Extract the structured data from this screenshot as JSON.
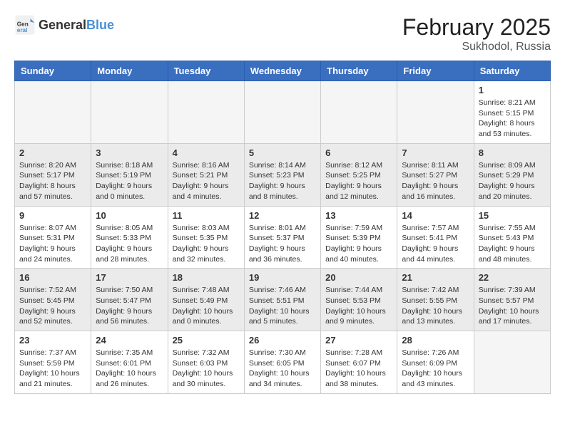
{
  "logo": {
    "text_general": "General",
    "text_blue": "Blue"
  },
  "header": {
    "month_year": "February 2025",
    "location": "Sukhodol, Russia"
  },
  "weekdays": [
    "Sunday",
    "Monday",
    "Tuesday",
    "Wednesday",
    "Thursday",
    "Friday",
    "Saturday"
  ],
  "weeks": [
    [
      {
        "day": "",
        "info": ""
      },
      {
        "day": "",
        "info": ""
      },
      {
        "day": "",
        "info": ""
      },
      {
        "day": "",
        "info": ""
      },
      {
        "day": "",
        "info": ""
      },
      {
        "day": "",
        "info": ""
      },
      {
        "day": "1",
        "info": "Sunrise: 8:21 AM\nSunset: 5:15 PM\nDaylight: 8 hours and 53 minutes."
      }
    ],
    [
      {
        "day": "2",
        "info": "Sunrise: 8:20 AM\nSunset: 5:17 PM\nDaylight: 8 hours and 57 minutes."
      },
      {
        "day": "3",
        "info": "Sunrise: 8:18 AM\nSunset: 5:19 PM\nDaylight: 9 hours and 0 minutes."
      },
      {
        "day": "4",
        "info": "Sunrise: 8:16 AM\nSunset: 5:21 PM\nDaylight: 9 hours and 4 minutes."
      },
      {
        "day": "5",
        "info": "Sunrise: 8:14 AM\nSunset: 5:23 PM\nDaylight: 9 hours and 8 minutes."
      },
      {
        "day": "6",
        "info": "Sunrise: 8:12 AM\nSunset: 5:25 PM\nDaylight: 9 hours and 12 minutes."
      },
      {
        "day": "7",
        "info": "Sunrise: 8:11 AM\nSunset: 5:27 PM\nDaylight: 9 hours and 16 minutes."
      },
      {
        "day": "8",
        "info": "Sunrise: 8:09 AM\nSunset: 5:29 PM\nDaylight: 9 hours and 20 minutes."
      }
    ],
    [
      {
        "day": "9",
        "info": "Sunrise: 8:07 AM\nSunset: 5:31 PM\nDaylight: 9 hours and 24 minutes."
      },
      {
        "day": "10",
        "info": "Sunrise: 8:05 AM\nSunset: 5:33 PM\nDaylight: 9 hours and 28 minutes."
      },
      {
        "day": "11",
        "info": "Sunrise: 8:03 AM\nSunset: 5:35 PM\nDaylight: 9 hours and 32 minutes."
      },
      {
        "day": "12",
        "info": "Sunrise: 8:01 AM\nSunset: 5:37 PM\nDaylight: 9 hours and 36 minutes."
      },
      {
        "day": "13",
        "info": "Sunrise: 7:59 AM\nSunset: 5:39 PM\nDaylight: 9 hours and 40 minutes."
      },
      {
        "day": "14",
        "info": "Sunrise: 7:57 AM\nSunset: 5:41 PM\nDaylight: 9 hours and 44 minutes."
      },
      {
        "day": "15",
        "info": "Sunrise: 7:55 AM\nSunset: 5:43 PM\nDaylight: 9 hours and 48 minutes."
      }
    ],
    [
      {
        "day": "16",
        "info": "Sunrise: 7:52 AM\nSunset: 5:45 PM\nDaylight: 9 hours and 52 minutes."
      },
      {
        "day": "17",
        "info": "Sunrise: 7:50 AM\nSunset: 5:47 PM\nDaylight: 9 hours and 56 minutes."
      },
      {
        "day": "18",
        "info": "Sunrise: 7:48 AM\nSunset: 5:49 PM\nDaylight: 10 hours and 0 minutes."
      },
      {
        "day": "19",
        "info": "Sunrise: 7:46 AM\nSunset: 5:51 PM\nDaylight: 10 hours and 5 minutes."
      },
      {
        "day": "20",
        "info": "Sunrise: 7:44 AM\nSunset: 5:53 PM\nDaylight: 10 hours and 9 minutes."
      },
      {
        "day": "21",
        "info": "Sunrise: 7:42 AM\nSunset: 5:55 PM\nDaylight: 10 hours and 13 minutes."
      },
      {
        "day": "22",
        "info": "Sunrise: 7:39 AM\nSunset: 5:57 PM\nDaylight: 10 hours and 17 minutes."
      }
    ],
    [
      {
        "day": "23",
        "info": "Sunrise: 7:37 AM\nSunset: 5:59 PM\nDaylight: 10 hours and 21 minutes."
      },
      {
        "day": "24",
        "info": "Sunrise: 7:35 AM\nSunset: 6:01 PM\nDaylight: 10 hours and 26 minutes."
      },
      {
        "day": "25",
        "info": "Sunrise: 7:32 AM\nSunset: 6:03 PM\nDaylight: 10 hours and 30 minutes."
      },
      {
        "day": "26",
        "info": "Sunrise: 7:30 AM\nSunset: 6:05 PM\nDaylight: 10 hours and 34 minutes."
      },
      {
        "day": "27",
        "info": "Sunrise: 7:28 AM\nSunset: 6:07 PM\nDaylight: 10 hours and 38 minutes."
      },
      {
        "day": "28",
        "info": "Sunrise: 7:26 AM\nSunset: 6:09 PM\nDaylight: 10 hours and 43 minutes."
      },
      {
        "day": "",
        "info": ""
      }
    ]
  ]
}
